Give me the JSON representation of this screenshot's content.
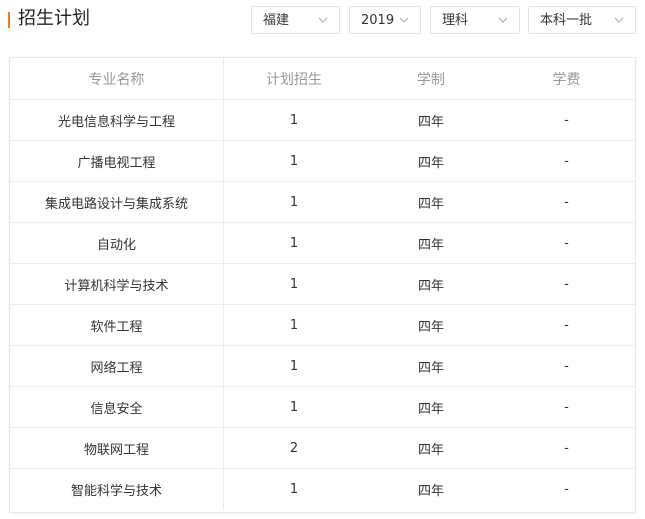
{
  "header": {
    "title": "招生计划"
  },
  "filters": [
    {
      "value": "福建"
    },
    {
      "value": "2019"
    },
    {
      "value": "理科"
    },
    {
      "value": "本科一批"
    }
  ],
  "table": {
    "columns": [
      "专业名称",
      "计划招生",
      "学制",
      "学费"
    ],
    "rows": [
      [
        "光电信息科学与工程",
        "1",
        "四年",
        "-"
      ],
      [
        "广播电视工程",
        "1",
        "四年",
        "-"
      ],
      [
        "集成电路设计与集成系统",
        "1",
        "四年",
        "-"
      ],
      [
        "自动化",
        "1",
        "四年",
        "-"
      ],
      [
        "计算机科学与技术",
        "1",
        "四年",
        "-"
      ],
      [
        "软件工程",
        "1",
        "四年",
        "-"
      ],
      [
        "网络工程",
        "1",
        "四年",
        "-"
      ],
      [
        "信息安全",
        "1",
        "四年",
        "-"
      ],
      [
        "物联网工程",
        "2",
        "四年",
        "-"
      ],
      [
        "智能科学与技术",
        "1",
        "四年",
        "-"
      ]
    ]
  },
  "colors": {
    "accent": "#f27a1a",
    "header_text": "#999999",
    "border": "#ececec"
  }
}
